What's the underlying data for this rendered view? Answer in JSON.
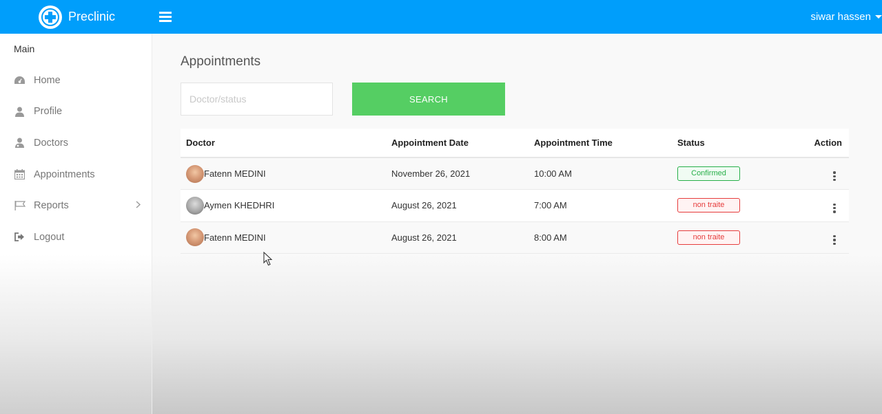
{
  "app": {
    "name": "Preclinic"
  },
  "header": {
    "user_name": "siwar hassen"
  },
  "sidebar": {
    "title": "Main",
    "items": [
      {
        "label": "Home",
        "icon": "dashboard-icon"
      },
      {
        "label": "Profile",
        "icon": "user-icon"
      },
      {
        "label": "Doctors",
        "icon": "doctor-icon"
      },
      {
        "label": "Appointments",
        "icon": "calendar-icon"
      },
      {
        "label": "Reports",
        "icon": "flag-icon",
        "has_submenu": true
      },
      {
        "label": "Logout",
        "icon": "logout-icon"
      }
    ]
  },
  "main": {
    "title": "Appointments",
    "search": {
      "placeholder": "Doctor/status",
      "value": "",
      "button_label": "SEARCH"
    },
    "table": {
      "columns": [
        "Doctor",
        "Appointment Date",
        "Appointment Time",
        "Status",
        "Action"
      ],
      "rows": [
        {
          "doctor": "Fatenn MEDINI",
          "date": "November 26, 2021",
          "time": "10:00 AM",
          "status": "Confirmed"
        },
        {
          "doctor": "Aymen KHEDHRI",
          "date": "August 26, 2021",
          "time": "7:00 AM",
          "status": "non traite"
        },
        {
          "doctor": "Fatenn MEDINI",
          "date": "August 26, 2021",
          "time": "8:00 AM",
          "status": "non traite"
        }
      ]
    }
  },
  "colors": {
    "brand": "#009efb",
    "search_button": "#55ce63",
    "status_confirmed": "#26af48",
    "status_pending": "#e63c3c"
  }
}
